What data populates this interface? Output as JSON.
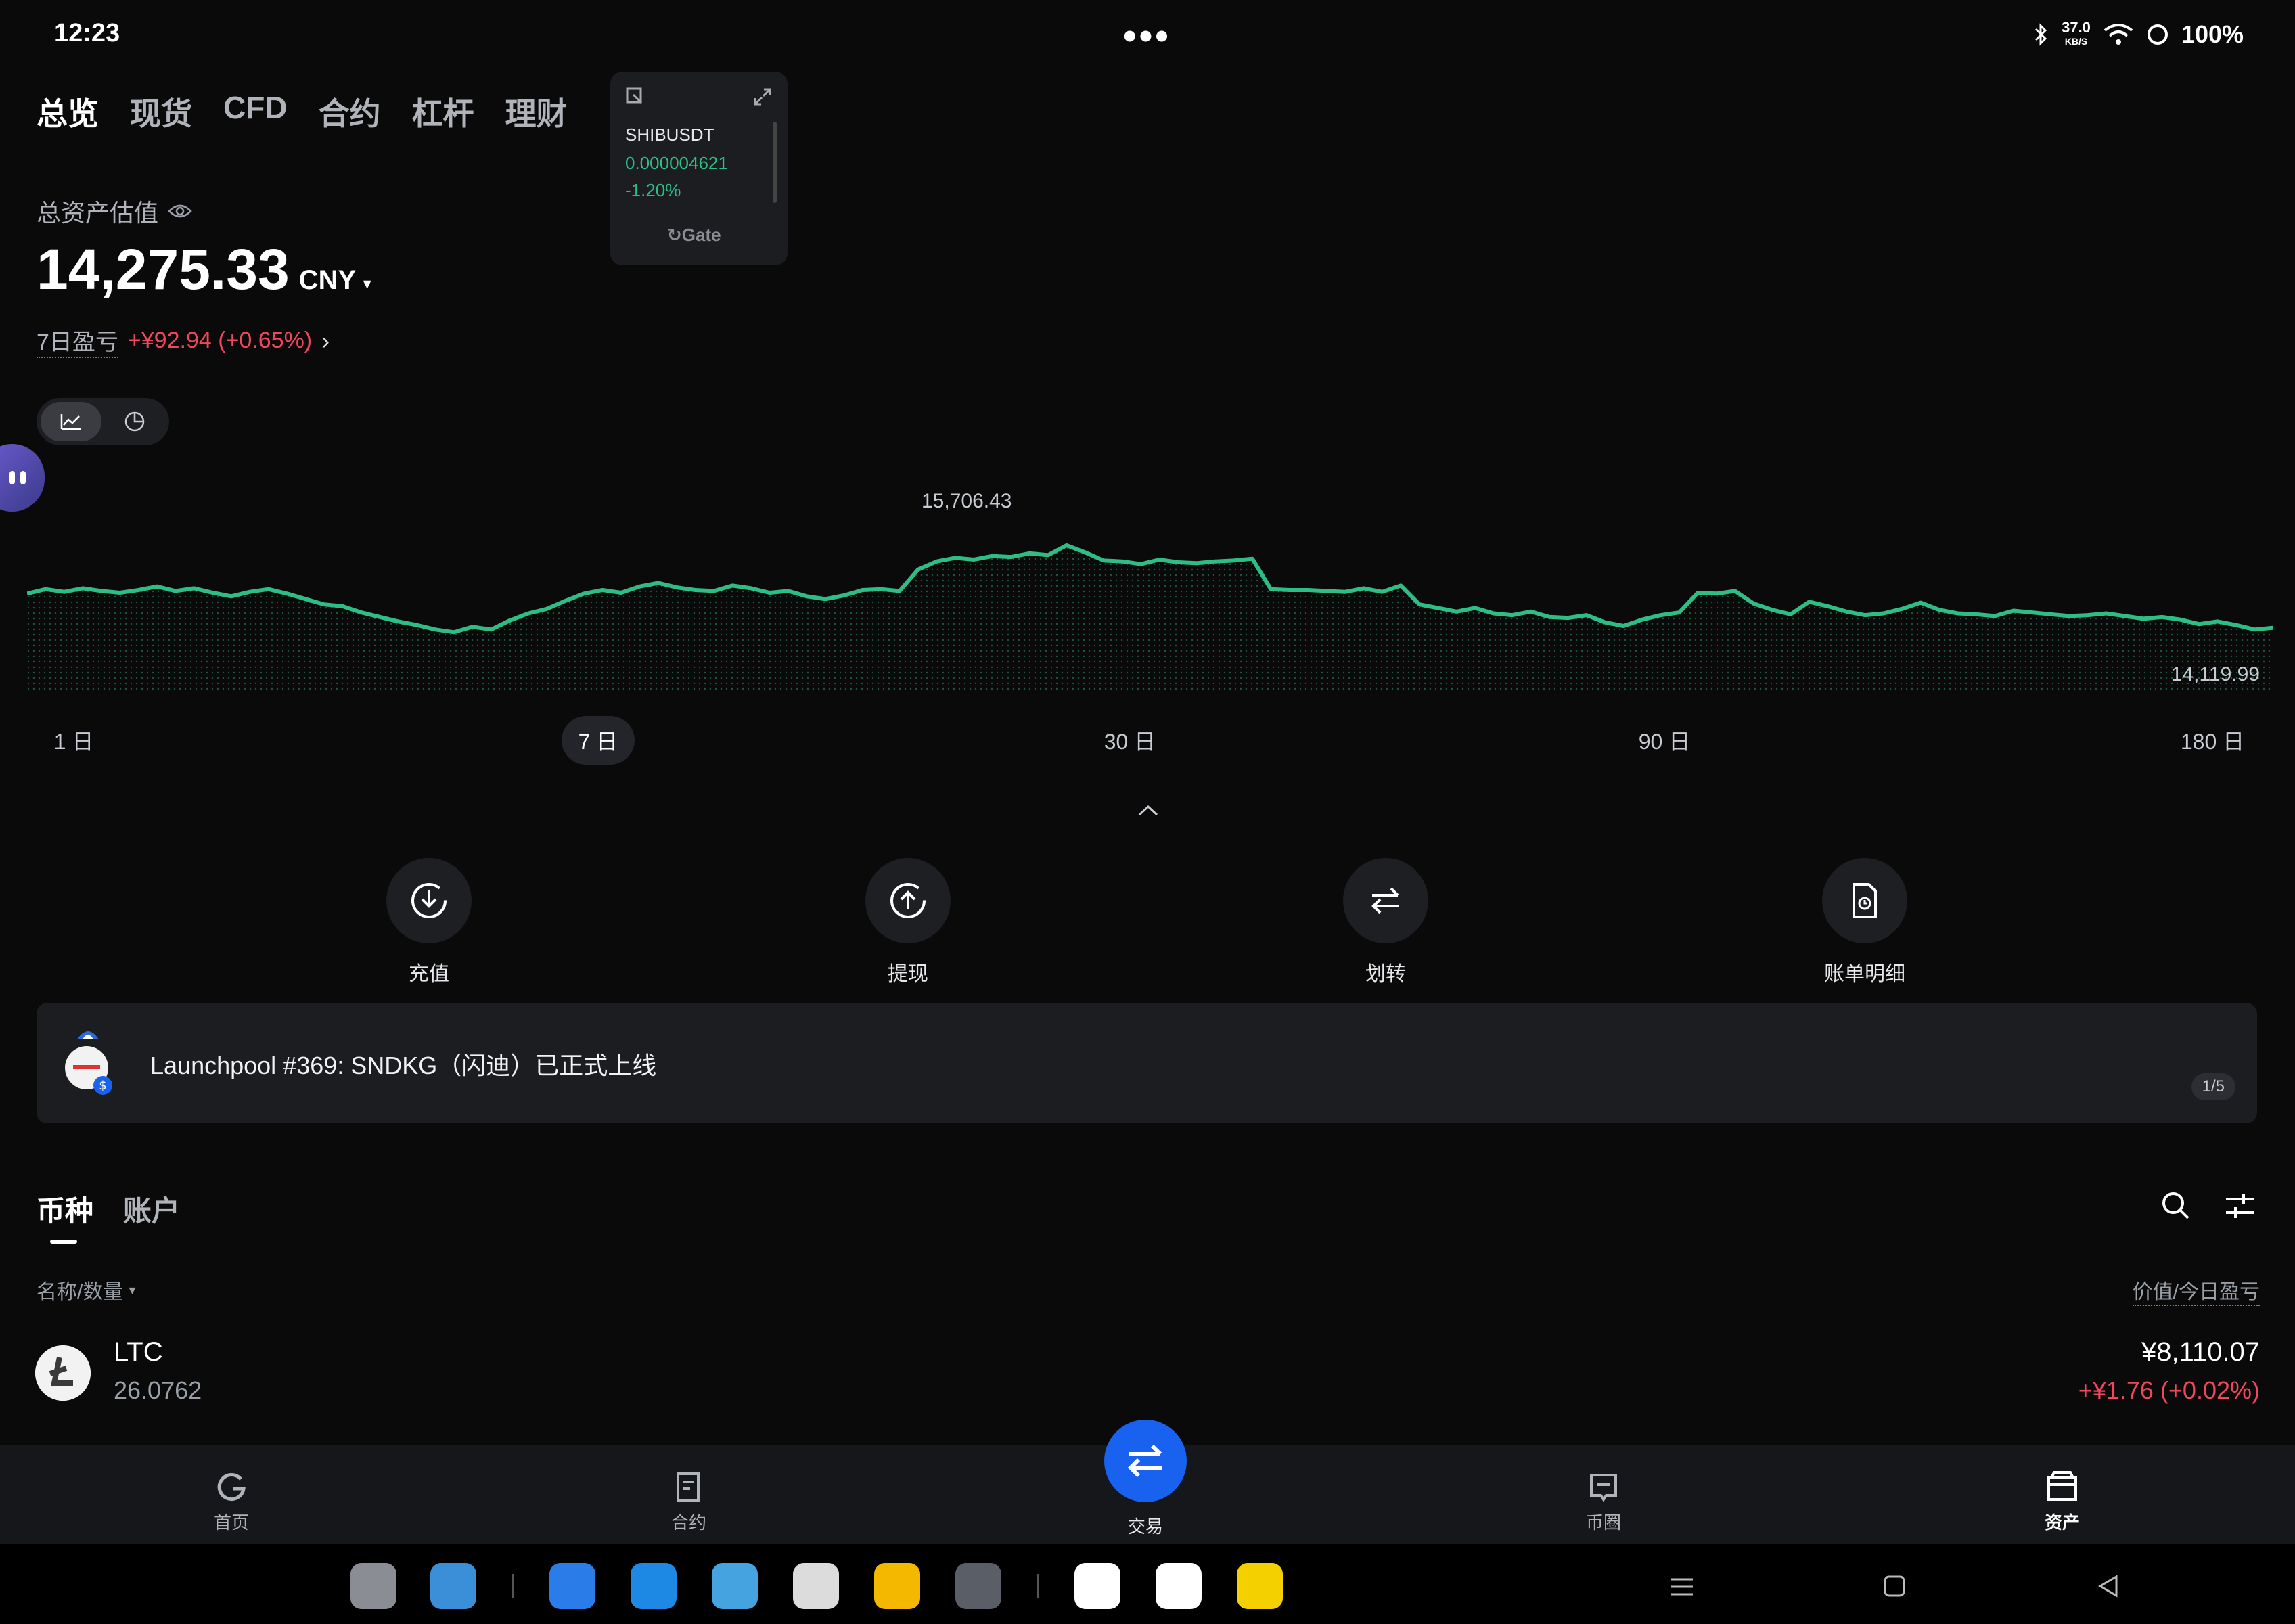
{
  "status": {
    "time": "12:23",
    "dots": "•••",
    "net_speed": "37.0",
    "net_unit": "KB/S",
    "battery": "100%"
  },
  "tabs": [
    "总览",
    "现货",
    "CFD",
    "合约",
    "杠杆",
    "理财"
  ],
  "widget": {
    "symbol": "SHIBUSDT",
    "price": "0.000004621",
    "change": "-1.20%",
    "brand": "Gate"
  },
  "total": {
    "label": "总资产估值",
    "amount": "14,275.33",
    "currency": "CNY"
  },
  "pnl": {
    "label": "7日盈亏",
    "value": "+¥92.94 (+0.65%)"
  },
  "chart": {
    "max_label": "15,706.43",
    "min_label": "14,119.99"
  },
  "chart_data": {
    "type": "area",
    "values": [
      14820,
      14870,
      14840,
      14880,
      14850,
      14830,
      14860,
      14900,
      14850,
      14880,
      14830,
      14790,
      14840,
      14870,
      14820,
      14760,
      14700,
      14680,
      14610,
      14560,
      14510,
      14470,
      14420,
      14390,
      14450,
      14420,
      14520,
      14600,
      14650,
      14740,
      14820,
      14860,
      14830,
      14900,
      14940,
      14890,
      14860,
      14850,
      14910,
      14880,
      14830,
      14850,
      14790,
      14760,
      14800,
      14860,
      14870,
      14850,
      15090,
      15180,
      15220,
      15200,
      15240,
      15230,
      15270,
      15250,
      15360,
      15280,
      15190,
      15180,
      15150,
      15200,
      15170,
      15160,
      15180,
      15190,
      15210,
      14870,
      14860,
      14860,
      14850,
      14840,
      14880,
      14840,
      14910,
      14700,
      14660,
      14620,
      14660,
      14600,
      14580,
      14620,
      14560,
      14550,
      14580,
      14500,
      14460,
      14530,
      14580,
      14610,
      14830,
      14820,
      14850,
      14710,
      14640,
      14590,
      14730,
      14680,
      14620,
      14580,
      14600,
      14650,
      14720,
      14640,
      14600,
      14590,
      14570,
      14630,
      14610,
      14590,
      14570,
      14580,
      14600,
      14570,
      14540,
      14560,
      14530,
      14480,
      14510,
      14470,
      14420,
      14440
    ],
    "ylim": [
      14119.99,
      15706.43
    ]
  },
  "ranges": [
    "1 日",
    "7 日",
    "30 日",
    "90 日",
    "180 日"
  ],
  "actions": [
    "充值",
    "提现",
    "划转",
    "账单明细"
  ],
  "banner": {
    "text": "Launchpool #369: SNDKG（闪迪）已正式上线",
    "page": "1/5"
  },
  "list_tabs": [
    "币种",
    "账户"
  ],
  "list_header": {
    "left": "名称/数量",
    "right": "价值/今日盈亏"
  },
  "assets": [
    {
      "name": "LTC",
      "qty": "26.0762",
      "value": "¥8,110.07",
      "pnl": "+¥1.76 (+0.02%)"
    }
  ],
  "nav": [
    "首页",
    "合约",
    "交易",
    "币圈",
    "资产"
  ],
  "colors": {
    "accent_green": "#2ebd85",
    "loss_red": "#f0475b",
    "trade_blue": "#1962f0"
  }
}
